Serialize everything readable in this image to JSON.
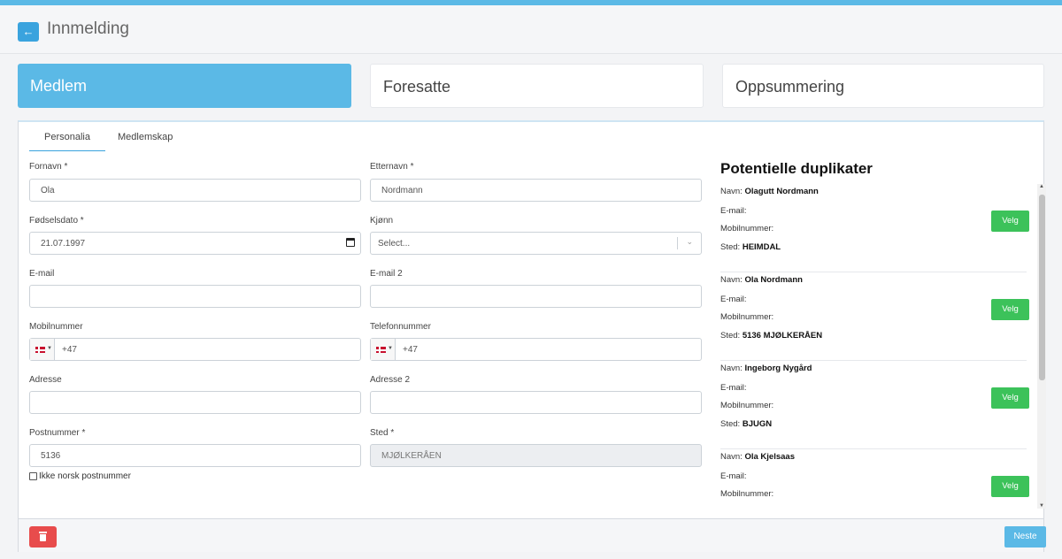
{
  "header": {
    "title": "Innmelding",
    "back_icon": "arrow-left-icon"
  },
  "steps": [
    {
      "label": "Medlem",
      "active": true
    },
    {
      "label": "Foresatte",
      "active": false
    },
    {
      "label": "Oppsummering",
      "active": false
    }
  ],
  "tabs": [
    {
      "label": "Personalia",
      "active": true
    },
    {
      "label": "Medlemskap",
      "active": false
    }
  ],
  "form": {
    "fornavn": {
      "label": "Fornavn *",
      "value": "Ola"
    },
    "etternavn": {
      "label": "Etternavn *",
      "value": "Nordmann"
    },
    "fodselsdato": {
      "label": "Fødselsdato *",
      "value": "21.07.1997"
    },
    "kjonn": {
      "label": "Kjønn",
      "placeholder": "Select..."
    },
    "email": {
      "label": "E-mail",
      "value": ""
    },
    "email2": {
      "label": "E-mail 2",
      "value": ""
    },
    "mobil": {
      "label": "Mobilnummer",
      "value": "+47"
    },
    "telefon": {
      "label": "Telefonnummer",
      "value": "+47"
    },
    "adresse": {
      "label": "Adresse",
      "value": ""
    },
    "adresse2": {
      "label": "Adresse 2",
      "value": ""
    },
    "postnummer": {
      "label": "Postnummer *",
      "value": "5136"
    },
    "sted": {
      "label": "Sted *",
      "value": "MJØLKERÅEN"
    },
    "ikke_norsk": {
      "label": "Ikke norsk postnummer",
      "checked": false
    }
  },
  "duplicates": {
    "title": "Potentielle duplikater",
    "labels": {
      "navn": "Navn:",
      "email": "E-mail:",
      "mobil": "Mobilnummer:",
      "sted": "Sted:"
    },
    "select_label": "Velg",
    "items": [
      {
        "navn": "Olagutt Nordmann",
        "sted": "HEIMDAL"
      },
      {
        "navn": "Ola Nordmann",
        "sted": "5136 MJØLKERÅEN"
      },
      {
        "navn": "Ingeborg Nygård",
        "sted": "BJUGN"
      },
      {
        "navn": "Ola Kjelsaas",
        "sted": ""
      }
    ]
  },
  "footer": {
    "next_label": "Neste",
    "delete_icon": "trash-icon"
  },
  "colors": {
    "accent": "#5bb9e6",
    "select_button": "#3cc25a",
    "delete_button": "#e84c4c"
  }
}
